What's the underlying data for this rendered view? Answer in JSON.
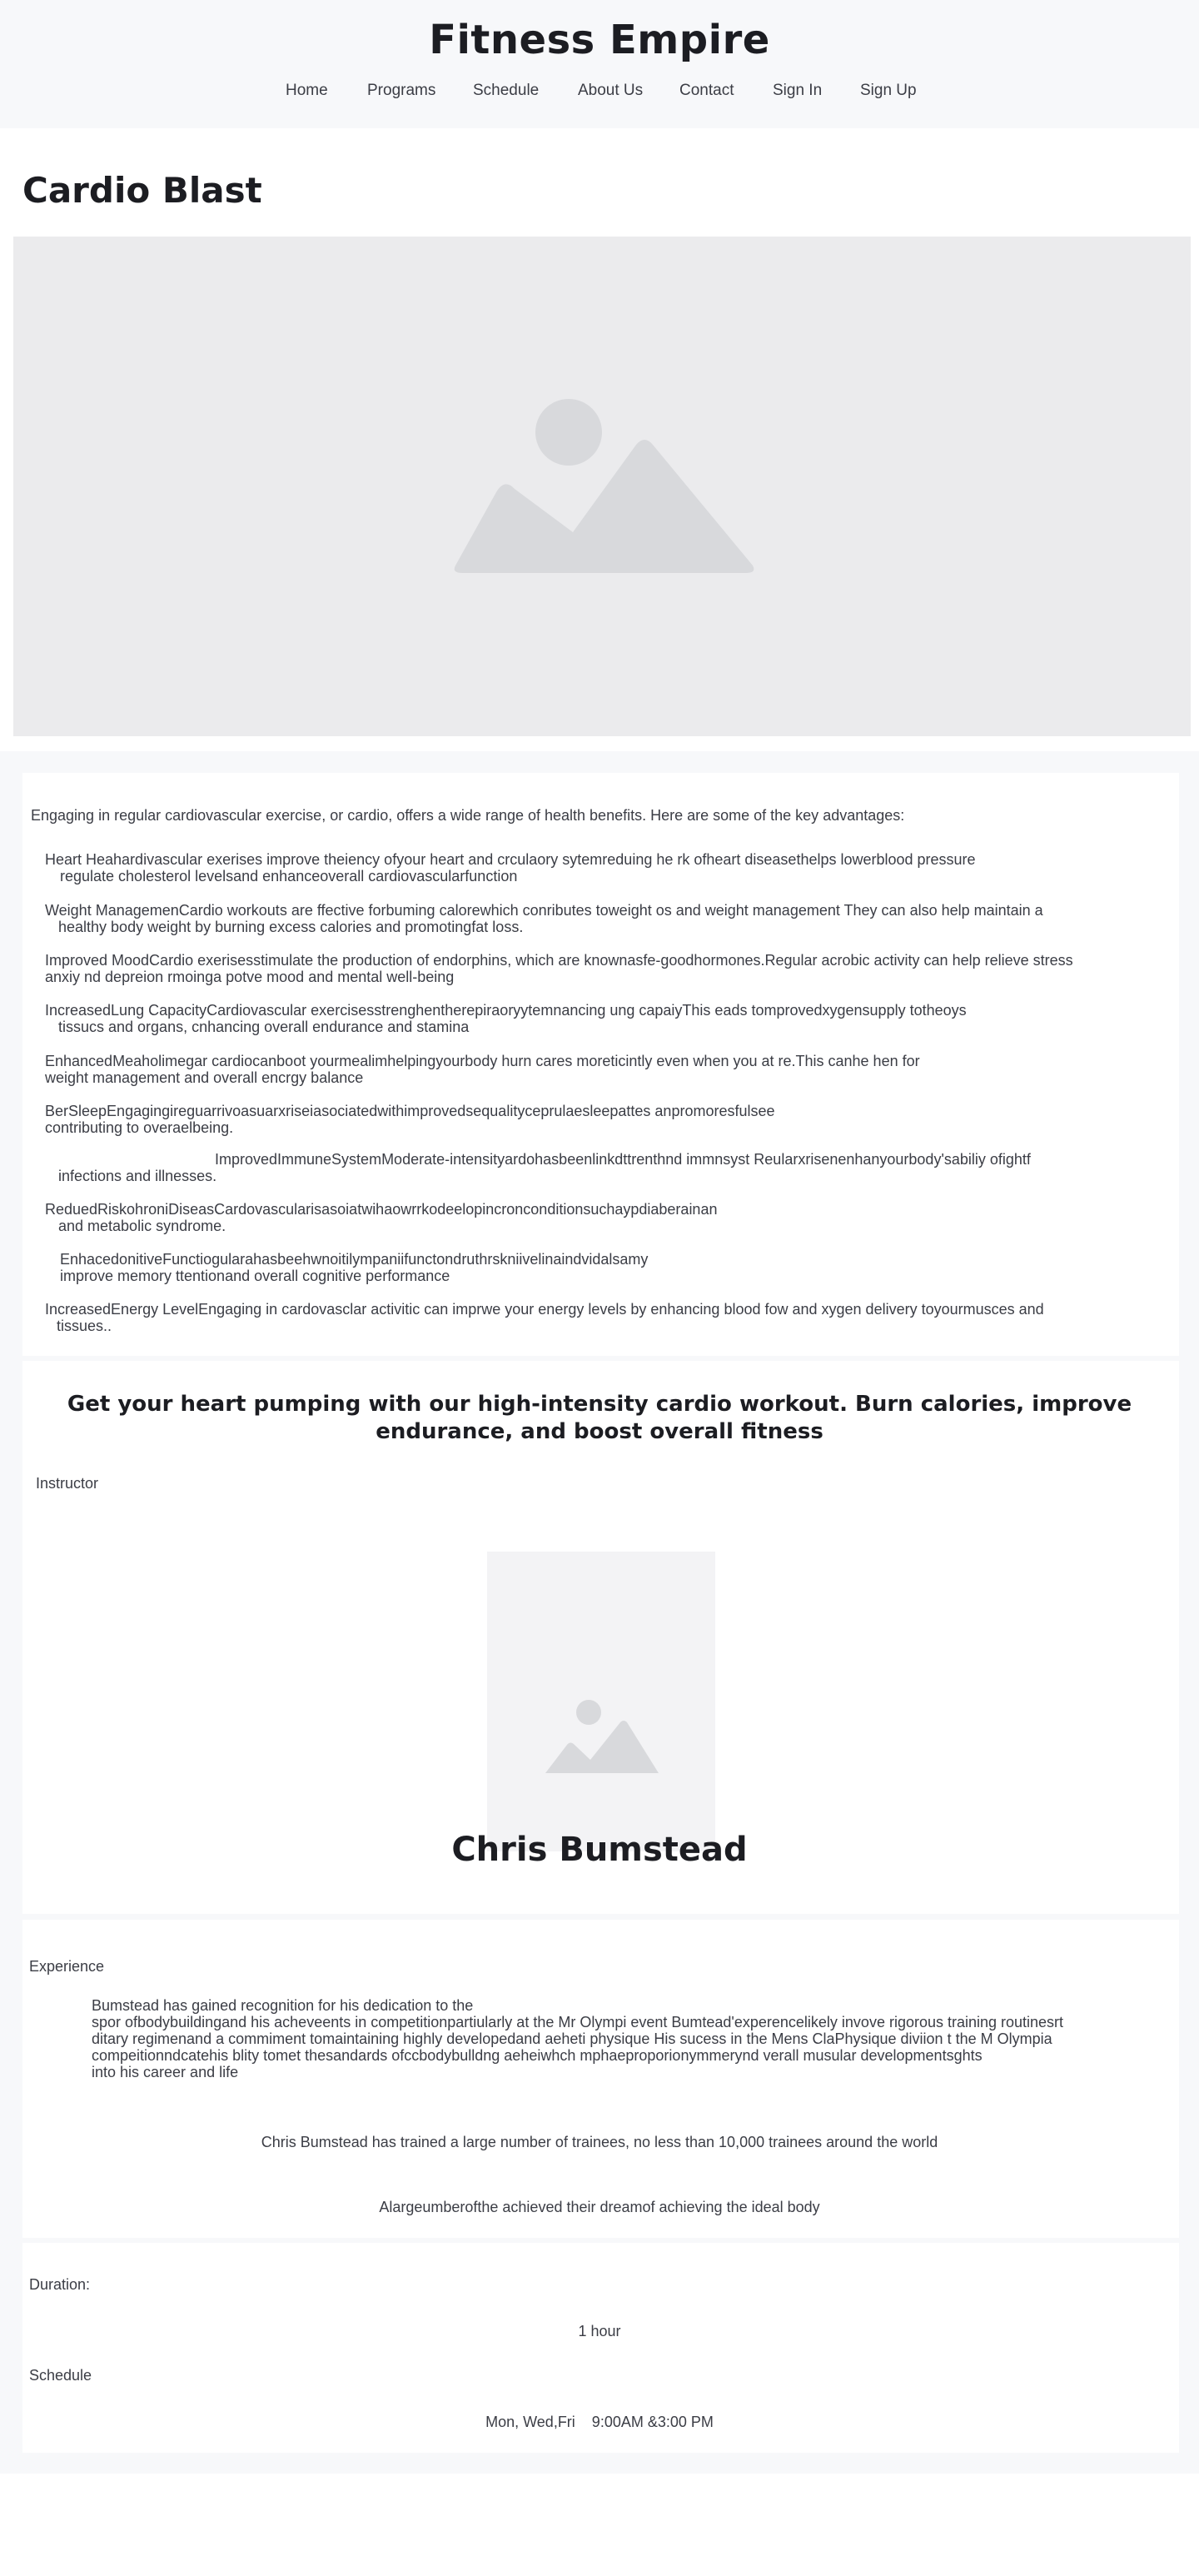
{
  "site": {
    "brand": "Fitness Empire",
    "nav": [
      "Home",
      "Programs",
      "Schedule",
      "About Us",
      "Contact",
      "Sign In",
      "Sign Up"
    ]
  },
  "program": {
    "title": "Cardio Blast",
    "intro": "Engaging in regular cardiovascular exercise, or cardio, offers a wide range of health benefits. Here are some of the key advantages:",
    "benefits": [
      {
        "line1": "Heart Heahardivascular exerises improve theiency ofyour heart and crculaory sytemreduing he rk ofheart diseasethelps lowerblood pressure",
        "line2": "regulate cholesterol levelsand enhanceoverall cardiovascularfunction"
      },
      {
        "line1": "Weight ManagemenCardio workouts are ffective forbuming calorewhich conributes toweight os and weight management They can also help maintain a",
        "line2": "healthy body weight by burning excess calories and promotingfat loss."
      },
      {
        "line1": "Improved MoodCardio exerisesstimulate the production of endorphins, which are knownasfe-goodhormones.Regular acrobic activity can help relieve stress",
        "line2": "anxiy nd depreion rmoinga potve mood and mental well-being"
      },
      {
        "line1": "IncreasedLung CapacityCardiovascular exercisesstrenghentherepiraoryytemnancing ung capaiyThis eads tomprovedxygensupply totheoys",
        "line2": "tissucs and organs, cnhancing overall endurance and stamina"
      },
      {
        "line1": "EnhancedMeaholimegar cardiocanboot yourmealimhelpingyourbody hurn cares moreticintly even when you at re.This canhe hen for",
        "line2": "weight management and overall encrgy balance"
      },
      {
        "line1": "BerSleepEngagingireguarrivoasuarxriseiasociatedwithimprovedsequalityceprulaesleepattes anpromoresfulsee",
        "line2": "contributing to overaelbeing."
      },
      {
        "line1": "ImprovedImmuneSystemModerate-intensityardohasbeenlinkdttrenthnd immnsyst Reularxrisenenhanyourbody'sabiliy ofightf",
        "line2": "infections and illnesses."
      },
      {
        "line1": "ReduedRiskohroniDiseasCardovascularisasoiatwihaowrrkodeelopincronconditionsuchaypdiaberainan",
        "line2": "and metabolic syndrome."
      },
      {
        "line1": "EnhacedonitiveFunctiogularahasbeehwnoitilympaniifunctondruthrskniivelinaindvidalsamy",
        "line2": "improve memory ttentionand overall cognitive performance"
      },
      {
        "line1": "IncreasedEnergy LevelEngaging in cardovasclar activitic can imprwe your energy levels by enhancing blood fow and xygen delivery toyourmusces and",
        "line2": "tissues.."
      }
    ],
    "headline": "Get your heart pumping with our high-intensity cardio workout. Burn calories, improve endurance, and boost overall fitness"
  },
  "instructor": {
    "label": "Instructor",
    "name": "Chris Bumstead",
    "experience_label": "Experience",
    "experience_lines": [
      "Bumstead has gained recognition for his dedication to the",
      "spor ofbodybuildingand his acheveents in competitionpartiularly at the Mr Olympi event Bumtead'experencelikely invove rigorous training routinesrt",
      "ditary regimenand a commiment tomaintaining highly developedand aeheti physique His sucess in the Mens ClaPhysique diviion t the M Olympia",
      "compeitionndcatehis blity tomet thesandards ofccbodybulldng aeheiwhch mphaeproporionymmerynd verall musular developmentsghts",
      "into his career and life"
    ],
    "trainees": "Chris Bumstead has trained a large number of trainees, no less than 10,000 trainees around the world",
    "achievers": "Alargeumberofthe achieved their dreamof achieving the ideal body"
  },
  "details": {
    "duration_label": "Duration:",
    "duration": "1 hour",
    "schedule_label": "Schedule",
    "schedule": "Mon, Wed,Fri    9:00AM &3:00 PM"
  },
  "colors": {
    "header_bg": "#f7f8fa",
    "text_dark": "#1c1d22",
    "text_body": "#3b3d45",
    "placeholder_bg": "#ebebed",
    "placeholder_shape": "#d8d9dc"
  }
}
